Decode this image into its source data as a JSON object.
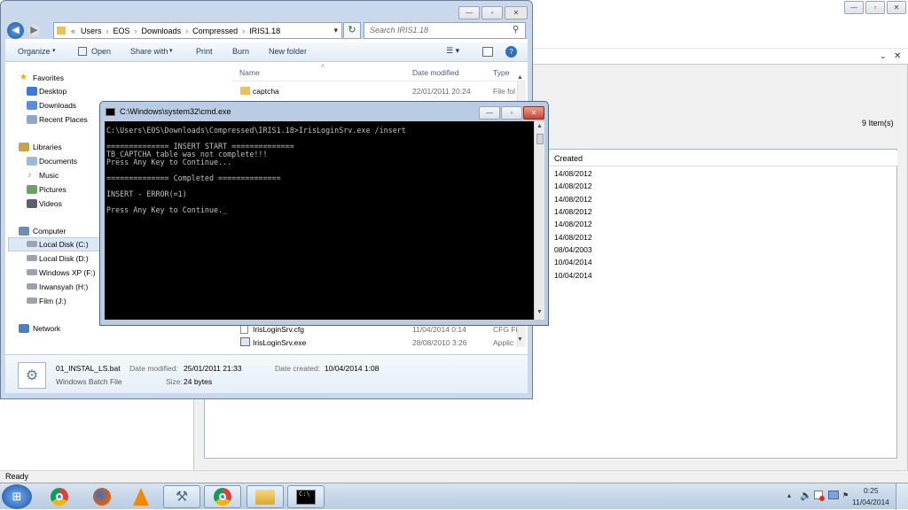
{
  "background_window": {
    "items_count": "9 Item(s)",
    "column_created": "Created",
    "created_dates": [
      "14/08/2012",
      "14/08/2012",
      "14/08/2012",
      "14/08/2012",
      "14/08/2012",
      "14/08/2012",
      "08/04/2003",
      "10/04/2014",
      "10/04/2014"
    ],
    "status_text": "Ready"
  },
  "explorer": {
    "breadcrumb": [
      "«",
      "Users",
      "EOS",
      "Downloads",
      "Compressed",
      "IRIS1.18"
    ],
    "search_placeholder": "Search IRIS1.18",
    "toolbar": [
      "Organize",
      "Open",
      "Share with",
      "Print",
      "Burn",
      "New folder"
    ],
    "nav": {
      "favorites": "Favorites",
      "favorites_items": [
        "Desktop",
        "Downloads",
        "Recent Places"
      ],
      "libraries": "Libraries",
      "libraries_items": [
        "Documents",
        "Music",
        "Pictures",
        "Videos"
      ],
      "computer": "Computer",
      "computer_items": [
        "Local Disk (C:)",
        "Local Disk (D:)",
        "Windows XP (F:)",
        "Irwansyah (H:)",
        "Film (J:)"
      ],
      "network": "Network"
    },
    "columns": {
      "name": "Name",
      "date": "Date modified",
      "type": "Type"
    },
    "files": [
      {
        "name": "captcha",
        "date": "22/01/2011 20:24",
        "type": "File fol"
      },
      {
        "name": "IrisLoginSrv.cfg",
        "date": "11/04/2014 0:14",
        "type": "CFG Fi"
      },
      {
        "name": "IrisLoginSrv.exe",
        "date": "28/08/2010 3:26",
        "type": "Applic"
      }
    ],
    "details": {
      "filename": "01_INSTAL_LS.bat",
      "filetype": "Windows Batch File",
      "modified_label": "Date modified:",
      "modified_value": "25/01/2011 21:33",
      "created_label": "Date created:",
      "created_value": "10/04/2014 1:08",
      "size_label": "Size:",
      "size_value": "24 bytes"
    }
  },
  "cmd": {
    "title": "C:\\Windows\\system32\\cmd.exe",
    "lines": [
      "C:\\Users\\EOS\\Downloads\\Compressed\\IRIS1.18>IrisLoginSrv.exe /insert",
      "",
      "============== INSERT START ==============",
      "TB_CAPTCHA table was not complete!!!",
      "Press Any Key to Continue...",
      "",
      "============== Completed ==============",
      "",
      "INSERT - ERROR(=1)",
      "",
      "Press Any Key to Continue._"
    ]
  },
  "taskbar": {
    "time": "0:25",
    "date": "11/04/2014",
    "apps": [
      "start",
      "chrome",
      "firefox",
      "vlc",
      "tools",
      "chrome",
      "explorer",
      "cmd"
    ]
  }
}
